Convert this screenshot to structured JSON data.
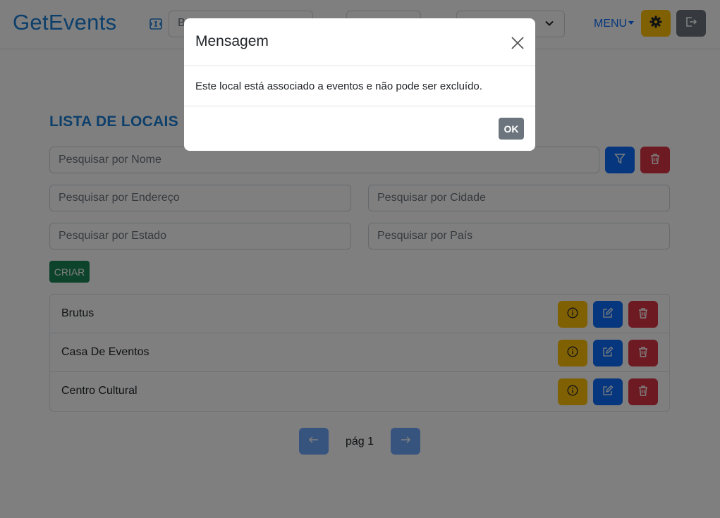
{
  "navbar": {
    "brand": "GetEvents",
    "search_value": "B",
    "menu_label": "MENU"
  },
  "page": {
    "title": "LISTA DE LOCAIS",
    "filters": {
      "name_placeholder": "Pesquisar por Nome",
      "address_placeholder": "Pesquisar por Endereço",
      "city_placeholder": "Pesquisar por Cidade",
      "state_placeholder": "Pesquisar por Estado",
      "country_placeholder": "Pesquisar por País"
    },
    "create_label": "CRIAR",
    "locations": [
      "Brutus",
      "Casa De Eventos",
      "Centro Cultural"
    ],
    "pagination_label": "pág 1"
  },
  "modal": {
    "title": "Mensagem",
    "message": "Este local está associado a eventos e não pode ser excluído.",
    "ok_label": "OK"
  },
  "colors": {
    "brand": "#1a7fd6",
    "primary": "#0d6efd",
    "warning": "#ffc107",
    "danger": "#dc3545",
    "success": "#198754",
    "secondary": "#6c757d"
  }
}
